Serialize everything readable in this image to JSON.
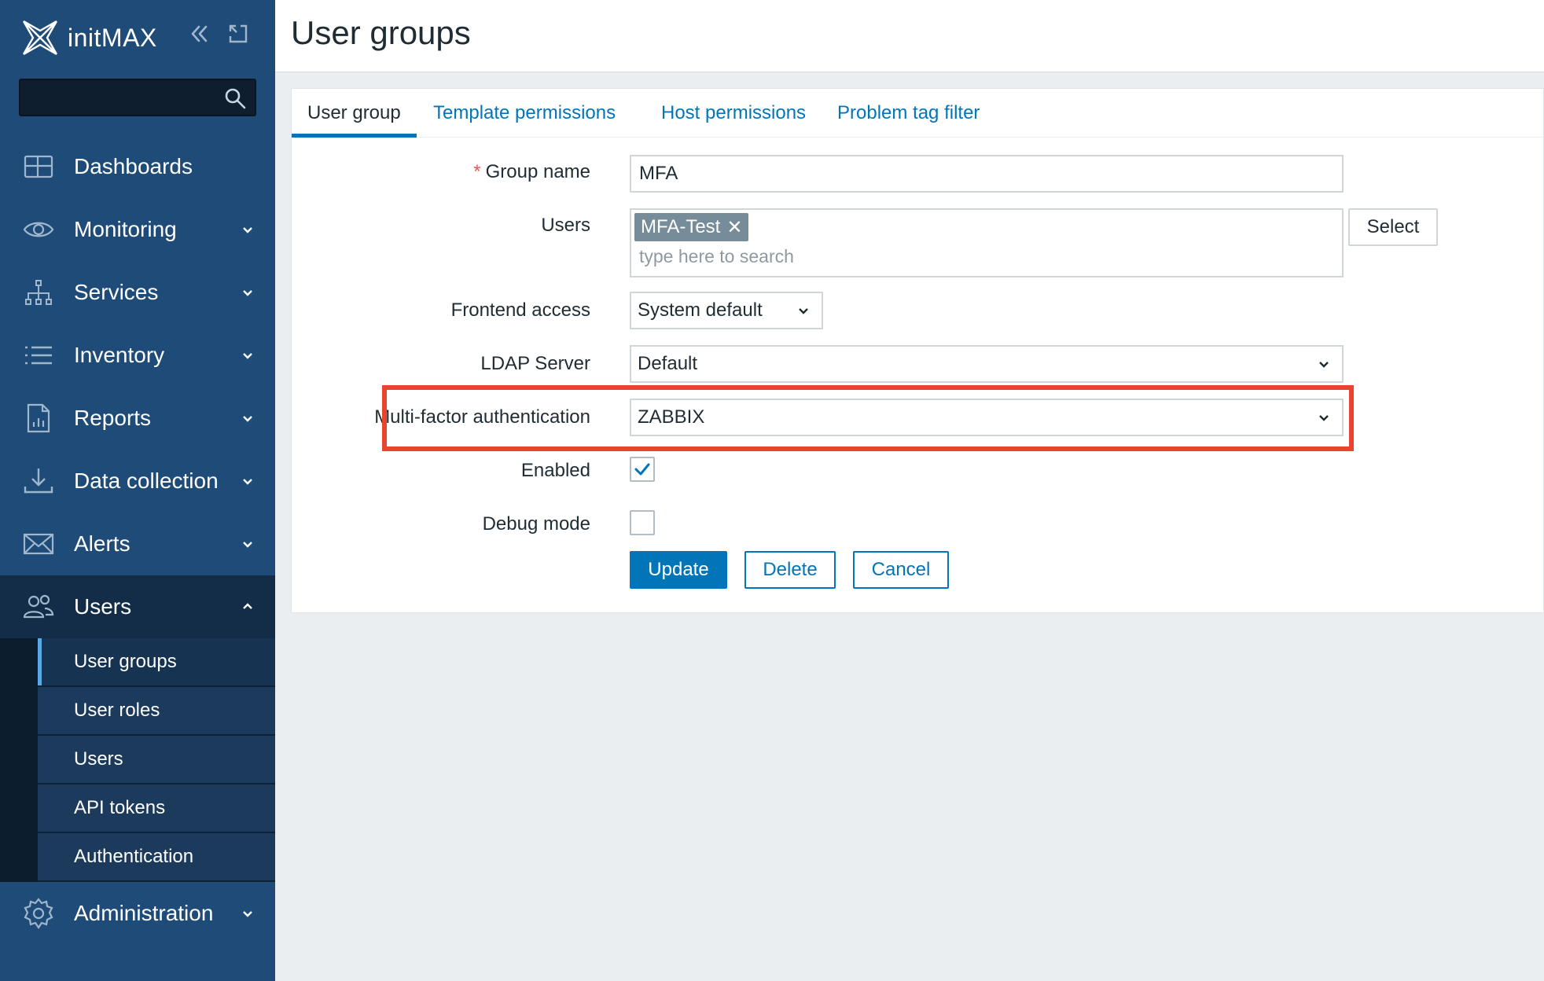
{
  "sidebar": {
    "brand": "initMAX",
    "search": {
      "placeholder": ""
    },
    "items": [
      {
        "label": "Dashboards",
        "icon": "dashboard-icon",
        "chevron": ""
      },
      {
        "label": "Monitoring",
        "icon": "eye-icon",
        "chevron": "down"
      },
      {
        "label": "Services",
        "icon": "hierarchy-icon",
        "chevron": "down"
      },
      {
        "label": "Inventory",
        "icon": "list-icon",
        "chevron": "down"
      },
      {
        "label": "Reports",
        "icon": "report-icon",
        "chevron": "down"
      },
      {
        "label": "Data collection",
        "icon": "download-icon",
        "chevron": "down"
      },
      {
        "label": "Alerts",
        "icon": "envelope-icon",
        "chevron": "down"
      },
      {
        "label": "Users",
        "icon": "users-icon",
        "chevron": "up"
      },
      {
        "label": "Administration",
        "icon": "gear-icon",
        "chevron": "down"
      }
    ],
    "users_submenu": [
      "User groups",
      "User roles",
      "Users",
      "API tokens",
      "Authentication"
    ]
  },
  "header": {
    "title": "User groups"
  },
  "tabs": [
    "User group",
    "Template permissions",
    "Host permissions",
    "Problem tag filter"
  ],
  "form": {
    "group_name": {
      "label": "Group name",
      "required_mark": "*",
      "value": "MFA"
    },
    "users": {
      "label": "Users",
      "chip": "MFA-Test",
      "chip_remove": "✕",
      "placeholder": "type here to search",
      "select_button": "Select"
    },
    "frontend_access": {
      "label": "Frontend access",
      "value": "System default"
    },
    "ldap_server": {
      "label": "LDAP Server",
      "value": "Default"
    },
    "mfa": {
      "label": "Multi-factor authentication",
      "value": "ZABBIX"
    },
    "enabled": {
      "label": "Enabled",
      "checked": true
    },
    "debug_mode": {
      "label": "Debug mode",
      "checked": false
    },
    "buttons": {
      "update": "Update",
      "delete": "Delete",
      "cancel": "Cancel"
    }
  },
  "colors": {
    "sidebar": "#1f4b78",
    "accent": "#0275b8",
    "highlight": "#e8442e"
  }
}
